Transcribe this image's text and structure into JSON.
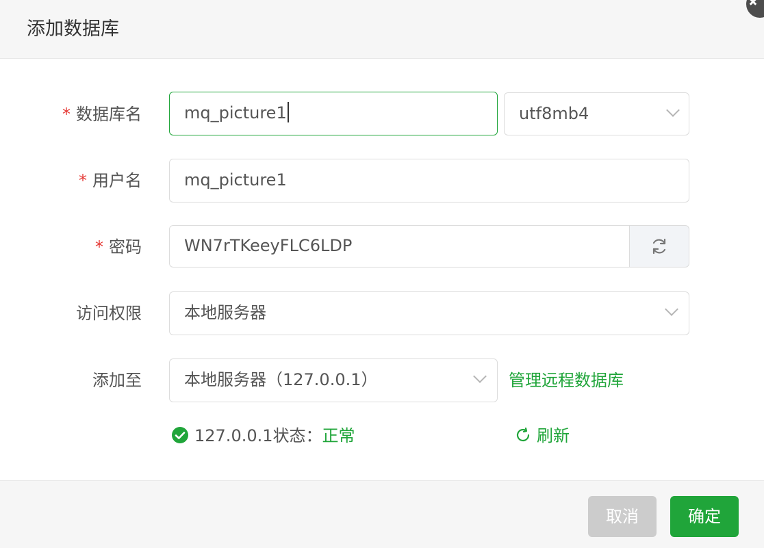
{
  "dialog": {
    "title": "添加数据库"
  },
  "form": {
    "required_mark": "*",
    "db_name": {
      "label": "数据库名",
      "value": "mq_picture1"
    },
    "charset": {
      "value": "utf8mb4"
    },
    "username": {
      "label": "用户名",
      "value": "mq_picture1"
    },
    "password": {
      "label": "密码",
      "value": "WN7rTKeeyFLC6LDP"
    },
    "access": {
      "label": "访问权限",
      "value": "本地服务器"
    },
    "add_to": {
      "label": "添加至",
      "value": "本地服务器（127.0.0.1）",
      "manage_link": "管理远程数据库"
    }
  },
  "status": {
    "host_text": "127.0.0.1状态：",
    "state": "正常",
    "refresh_label": "刷新"
  },
  "footer": {
    "cancel_label": "取消",
    "ok_label": "确定"
  },
  "colors": {
    "accent": "#20a53a",
    "required": "#e53935",
    "cancel_bg": "#cccccc"
  },
  "icons": {
    "password_refresh": "refresh-icon",
    "status": "check-circle-icon",
    "status_refresh": "refresh-icon",
    "dropdown": "chevron-down-icon",
    "close": "close-icon"
  }
}
